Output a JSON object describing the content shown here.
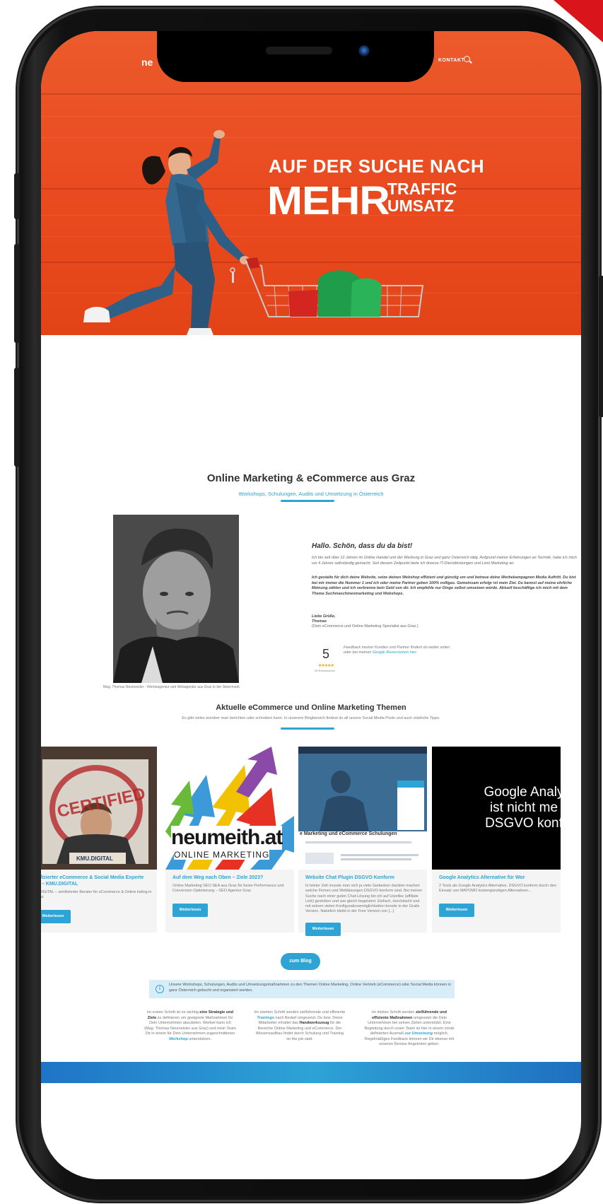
{
  "nav": {
    "logo_text": "ne",
    "contact_label": "KONTAKT",
    "search_icon": "search-icon"
  },
  "hero": {
    "headline": "AUF DER SUCHE NACH",
    "big_word": "MEHR",
    "word_1": "TRAFFIC",
    "word_2": "UMSATZ",
    "background_color": "#e94a1f"
  },
  "intro": {
    "title": "Online Marketing & eCommerce aus Graz",
    "subtitle": "Workshops, Schulungen, Audits und Umsetzung in Österreich",
    "portrait_caption": "Mag. Thomas Neumeister - Werbeagentur und Webagentur aus Graz in der Steiermark",
    "greeting_title": "Hallo. Schön, dass du da bist!",
    "greeting_p1": "Ich bin seit über 12 Jahren im Online Handel und der Werbung in Graz und ganz Österreich tätig. Aufgrund meiner Erfahrungen an Technik, habe ich mich vor 4 Jahren selbständig gemacht. Seit diesem Zeitpunkt biete ich diverse IT-Dienstleistungen und Leist Marketing an.",
    "greeting_p2": "Ich gestalte für dich deine Website, setze deinen Webshop effizient und günstig um und betreue deine Werbekampagnen Media Auftritt. Du bist bei mir immer die Nummer 1 und ich oder meine Partner geben 100% volligas. Gemeinsam erfolgr ist mein Ziel. Du kannst auf meine ehrliche Meinung zählen und ich verbrenne kein Geld von dir. Ich empfehle nur Dinge selbst umsetzen würde. Aktuell beschäftige ich mich mit dem Thema Suchmaschinenmarketing und Webshops.",
    "signoff_1": "Liebe Grüße,",
    "signoff_2": "Thomas",
    "signoff_role": "(Dein eCommerce und Online Marketing Spezialist aus Graz.)",
    "rating_value": "5",
    "rating_stars": "★★★★★",
    "rating_count": "25 Rezensionen",
    "feedback_text": "Feedback meiner Kunden und Partner findest du weiter unten oder bei meinen ",
    "feedback_link": "Google Rezensionen hier."
  },
  "blog": {
    "title": "Aktuelle eCommerce und Online Marketing Themen",
    "subtitle": "Es gibt vieles worüber man berichten oder schreiben kann. In unserem Blogbereich findest du all unsere Social Media Posts und auch nützliche Tipps.",
    "read_more": "Weiterlesen",
    "cards": [
      {
        "image_stamp": "CERTIFIED",
        "image_brand": "KMU.DIGITAL",
        "title_1": "rtifizierter eCommerce & Social Media Experte",
        "title_2": "E) – KMU.DIGITAL",
        "excerpt": "U.DIGITAL – zertifizierter Berater für eCommerce & Online keting in Graz"
      },
      {
        "image_brand": "neumeith.at",
        "image_tagline": "ONLINE MARKETING",
        "title_1": "Auf dem Weg nach Oben – Ziele 2023?",
        "excerpt": "Online Marketing SEO SEA aus Graz für beste Performance und Conversion Optimierung – SEO Agentur Graz"
      },
      {
        "image_caption": "e Marketing und eCommerce Schulungen",
        "title_1": "Website Chat Plugin DSGVO Konform",
        "excerpt": "In letzter Zeit musste man sich ja viele Gedanken darüber machen welche Firmen und Webläsungen DSGVO konform sind. Bei meiner Suche nach einer guten Chat-Lösung bin ich auf Userlike (affiliate Link) gestoßen und war gleich begeistert. Einfach, durchdacht und mit extrem vielen Konfigurationsmöglichkeiten bereits in der Gratis Version. Natürlich bleibt in der Free Version von [...]"
      },
      {
        "image_line_1": "Google Analy",
        "image_line_2": "ist nicht me",
        "image_line_3": "DSGVO konf",
        "title_1": "Google Analytics Alternative für Wor",
        "excerpt": "2 Tools als Google Analytics Alternative. DSGVO konform durch den Einsatz von MATOMO kostengünstigen Alternativen..."
      }
    ],
    "button_label": "zum Blog"
  },
  "info": {
    "icon": "info-icon",
    "text": "Unsere Workshops, Schulungen, Audits und Umsetzungsmaßnahmen zu den Themen Online Marketing, Online Vertrieb (eCommerce) oder Social Media können in ganz Österreich gebucht und organisiert werden."
  },
  "steps": [
    {
      "pre": "Im ersten Schritt ist es wichtig ",
      "kw": "eine Strategie und Ziele",
      "mid": " zu definieren um geeignete Maßnahmen für Dein Unternehmen abzuleiten. Werber:kann ich (Mag. Thomas Neumeister aus Graz) und mein Team Dir in einem für Dein Unternehmen zugeschnittenen ",
      "kw2": "Workshop",
      "post": " unterstützen."
    },
    {
      "pre": "Im zweiten Schritt werden zielführende und effiziente ",
      "kw": "Trainings",
      "mid": " nach Bedarf umgesetzt. Du bzw. Deine Mitarbeiter erhaltet das ",
      "kw2": "Handwerkszeug",
      "post": " für die Bereiche Online Marketing und eCommerce. Der Wissensaufbau findet durch Schulung und Training on the job statt."
    },
    {
      "pre": "Im letzten Schritt werden ",
      "kw": "zielführende und effiziente Maßnahmen",
      "mid": " umgesetzt die Dein Unternehmen bei seinen Zielen unterstützt. Eine Begleitung durch unser Team ist hier in einem vorab definierten Ausmaß ",
      "kw2": "zur Umsetzung",
      "post": " möglich. Regelmäßiges Feedback können wir Dir ebenso mit unseren Review Angeboten geben."
    }
  ],
  "colors": {
    "accent": "#2ea3d6",
    "hero_orange": "#e94a1f",
    "phone_frame": "#111111"
  }
}
